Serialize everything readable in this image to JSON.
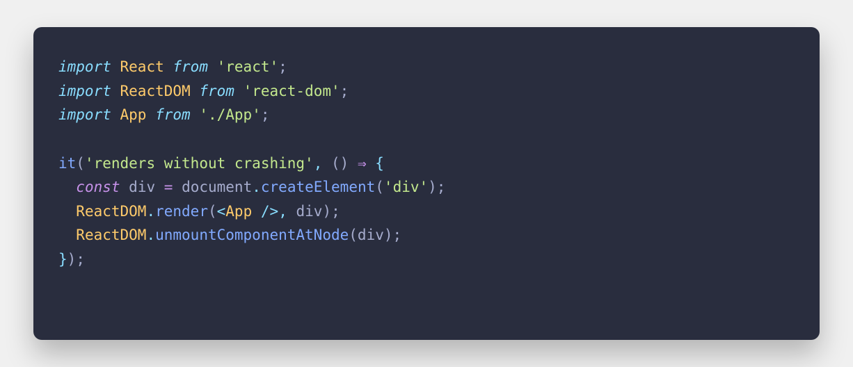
{
  "tokens": {
    "l1": {
      "import": "import",
      "ident": "React",
      "from": "from",
      "str": "'react'",
      "semi": ";"
    },
    "l2": {
      "import": "import",
      "ident": "ReactDOM",
      "from": "from",
      "str": "'react-dom'",
      "semi": ";"
    },
    "l3": {
      "import": "import",
      "ident": "App",
      "from": "from",
      "str": "'./App'",
      "semi": ";"
    },
    "l5": {
      "fn": "it",
      "lp": "(",
      "str": "'renders without crashing'",
      "comma": ",",
      "sp": " ",
      "ap": "(",
      "cp": ")",
      "arrow": "⇒",
      "brace": "{"
    },
    "l6": {
      "indent": "  ",
      "const": "const",
      "ident": "div",
      "eq": "=",
      "obj": "document",
      "dot": ".",
      "method": "createElement",
      "lp": "(",
      "str": "'div'",
      "rp": ")",
      "semi": ";"
    },
    "l7": {
      "indent": "  ",
      "obj": "ReactDOM",
      "dot1": ".",
      "method": "render",
      "lp": "(",
      "tb1": "<",
      "tag": "App",
      "sp": " ",
      "slash": "/",
      "tb2": ">",
      "comma": ",",
      "arg": "div",
      "rp": ")",
      "semi": ";"
    },
    "l8": {
      "indent": "  ",
      "obj": "ReactDOM",
      "dot1": ".",
      "method": "unmountComponentAtNode",
      "lp": "(",
      "arg": "div",
      "rp": ")",
      "semi": ";"
    },
    "l9": {
      "brace": "}",
      "rp": ")",
      "semi": ";"
    }
  }
}
